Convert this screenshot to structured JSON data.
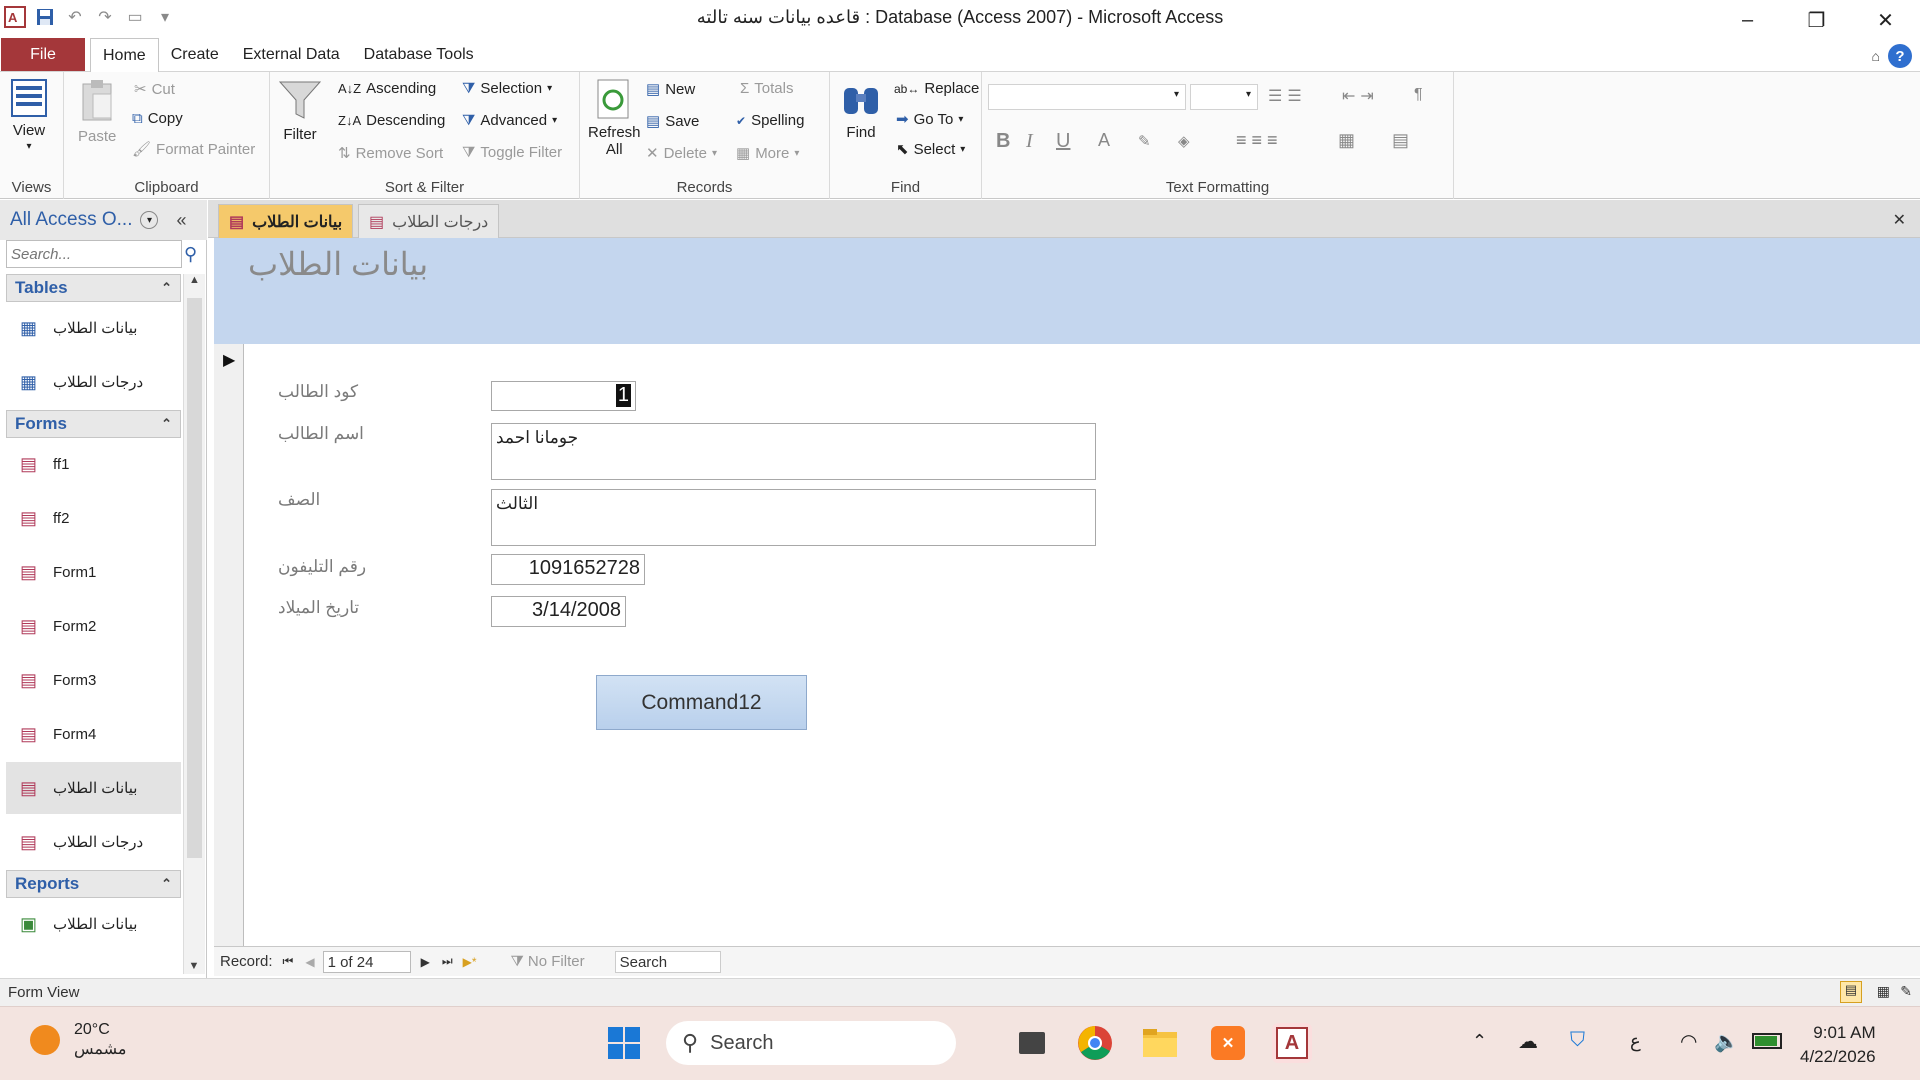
{
  "window": {
    "title": "قاعده بيانات سنه تالته : Database (Access 2007) - Microsoft Access",
    "minimize_label": "–",
    "restore_label": "❐",
    "close_label": "✕"
  },
  "menu": {
    "file": "File",
    "tabs": [
      "Home",
      "Create",
      "External Data",
      "Database Tools"
    ]
  },
  "ribbon": {
    "views": {
      "view": "View",
      "label": "Views"
    },
    "clipboard": {
      "paste": "Paste",
      "cut": "Cut",
      "copy": "Copy",
      "format_painter": "Format Painter",
      "label": "Clipboard"
    },
    "sort_filter": {
      "filter": "Filter",
      "ascending": "Ascending",
      "descending": "Descending",
      "remove_sort": "Remove Sort",
      "selection": "Selection",
      "advanced": "Advanced",
      "toggle_filter": "Toggle Filter",
      "label": "Sort & Filter"
    },
    "records": {
      "refresh": "Refresh",
      "refresh_all": "All",
      "new": "New",
      "save": "Save",
      "delete": "Delete",
      "totals": "Totals",
      "spelling": "Spelling",
      "more": "More",
      "label": "Records"
    },
    "find": {
      "find": "Find",
      "replace": "Replace",
      "goto": "Go To",
      "select": "Select",
      "label": "Find"
    },
    "text_formatting": {
      "bold": "B",
      "italic": "I",
      "underline": "U",
      "font_color": "A",
      "label": "Text Formatting"
    }
  },
  "nav_pane": {
    "title": "All Access O...",
    "search_placeholder": "Search...",
    "sections": [
      {
        "label": "Tables",
        "items": [
          "بيانات الطلاب",
          "درجات الطلاب"
        ]
      },
      {
        "label": "Forms",
        "items": [
          "ff1",
          "ff2",
          "Form1",
          "Form2",
          "Form3",
          "Form4",
          "بيانات الطلاب",
          "درجات الطلاب"
        ]
      },
      {
        "label": "Reports",
        "items": [
          "بيانات الطلاب"
        ]
      }
    ]
  },
  "doc_tabs": [
    "بيانات الطلاب",
    "درجات الطلاب"
  ],
  "form": {
    "title": "بيانات الطلاب",
    "fields": {
      "code": {
        "label": "كود الطالب",
        "value": "1"
      },
      "name": {
        "label": "اسم الطالب",
        "value": "جومانا احمد"
      },
      "grade": {
        "label": "الصف",
        "value": "الثالث"
      },
      "phone": {
        "label": "رقم التليفون",
        "value": "1091652728"
      },
      "birth": {
        "label": "تاريخ الميلاد",
        "value": "3/14/2008"
      }
    },
    "command_button": "Command12"
  },
  "record_nav": {
    "label": "Record:",
    "position": "1 of 24",
    "filter": "No Filter",
    "search": "Search"
  },
  "status_bar": {
    "mode": "Form View"
  },
  "taskbar": {
    "weather_temp": "20°C",
    "weather_desc": "مشمس",
    "search": "Search",
    "lang": "ع",
    "time": "9:01 AM",
    "date": "4/22/2026"
  },
  "colors": {
    "file_tab": "#a4373a",
    "form_header": "#c4d6ee",
    "nav_accent": "#2f5fa8",
    "button": "#c6daf1"
  }
}
